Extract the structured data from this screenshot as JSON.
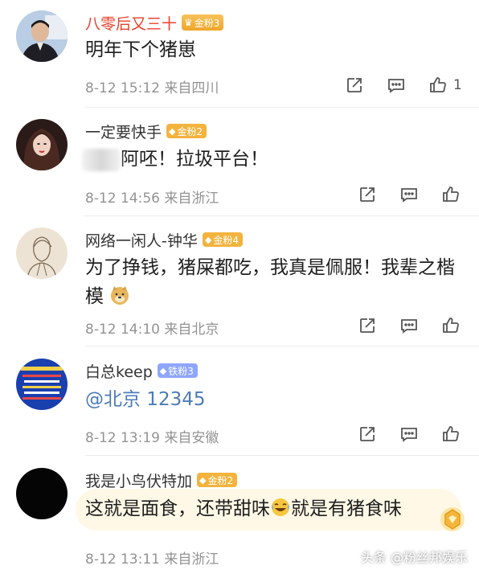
{
  "comments": [
    {
      "username": "八零后又三十",
      "badge": "金粉3",
      "text": "明年下个猪崽",
      "time": "8-12 15:12",
      "location": "来自四川",
      "like_count": "1"
    },
    {
      "username": "一定要快手",
      "badge": "金粉2",
      "text": "阿呸！拉圾平台！",
      "time": "8-12 14:56",
      "location": "来自浙江"
    },
    {
      "username": "网络一闲人-钟华",
      "badge": "金粉4",
      "text": "为了挣钱，猪屎都吃，我真是佩服！我辈之楷模",
      "time": "8-12 14:10",
      "location": "来自北京"
    },
    {
      "username": "白总keep",
      "badge": "铁粉3",
      "text": "@北京 12345",
      "time": "8-12 13:19",
      "location": "来自安徽"
    },
    {
      "username": "我是小鸟伏特加",
      "badge": "金粉2",
      "text_part1": "这就是面食，还带甜味",
      "text_part2": "就是有猪食味",
      "time": "8-12 13:11",
      "location": "来自浙江"
    }
  ],
  "watermark": "头条 @粉丝邦娱乐",
  "colors": {
    "highlight_name": "#e8412b",
    "link": "#4c7bb8",
    "gold_badge": "#f3b33d",
    "iron_badge": "#8fa6ff",
    "meta": "#939393"
  },
  "icons": [
    "share-icon",
    "comment-icon",
    "like-icon",
    "crown-icon",
    "laugh-cry-emoji",
    "doge-emoji"
  ]
}
